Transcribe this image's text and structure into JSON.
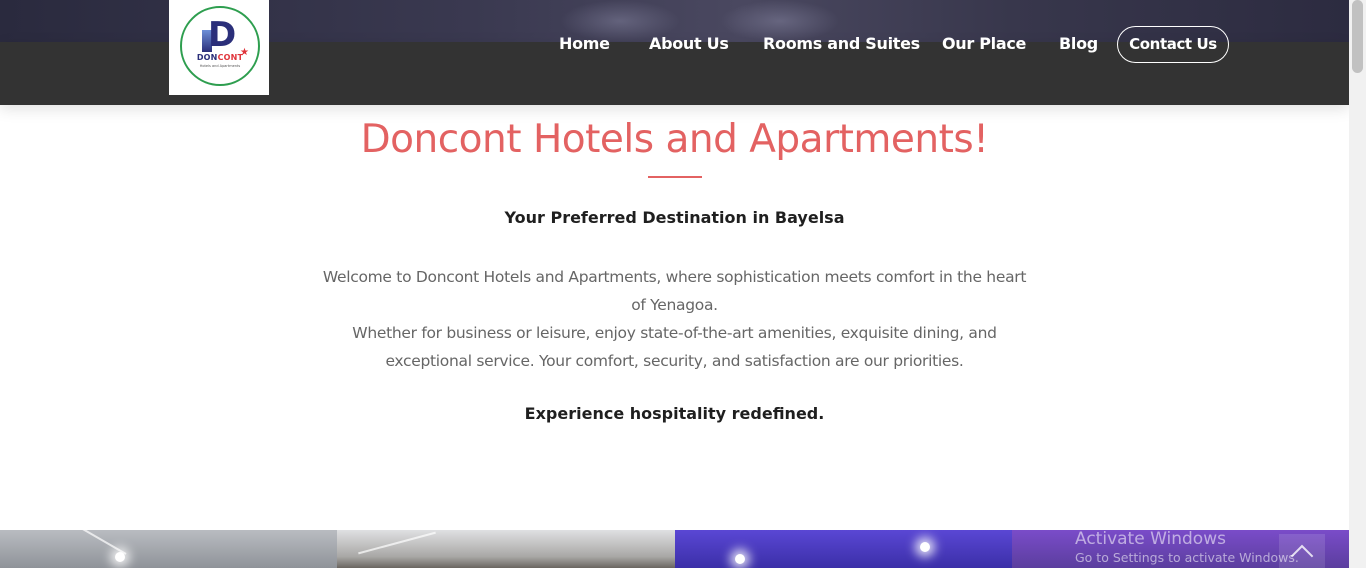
{
  "brand": {
    "logo_word_a": "DON",
    "logo_word_b": "CONT",
    "logo_sub": "Hotels and Apartments"
  },
  "nav": {
    "items": [
      {
        "label": "Home"
      },
      {
        "label": "About Us"
      },
      {
        "label": "Rooms and Suites"
      },
      {
        "label": "Our Place"
      },
      {
        "label": "Blog"
      }
    ],
    "contact_label": "Contact Us"
  },
  "intro": {
    "title": "Doncont Hotels and Apartments!",
    "subtitle": "Your Preferred Destination in Bayelsa",
    "paragraph_1": "Welcome to Doncont Hotels and Apartments, where sophistication meets comfort in the heart of Yenagoa.",
    "paragraph_2": "Whether for business or leisure, enjoy state-of-the-art amenities, exquisite dining, and exceptional service. Your comfort, security, and satisfaction are our priorities.",
    "tagline": "Experience hospitality redefined."
  },
  "overlay": {
    "activate_title": "Activate Windows",
    "activate_sub": "Go to Settings to activate Windows."
  },
  "colors": {
    "accent": "#e36262",
    "navbar": "#333333",
    "logo_ring": "#2e9e4f",
    "logo_blue": "#2b2f7a"
  }
}
